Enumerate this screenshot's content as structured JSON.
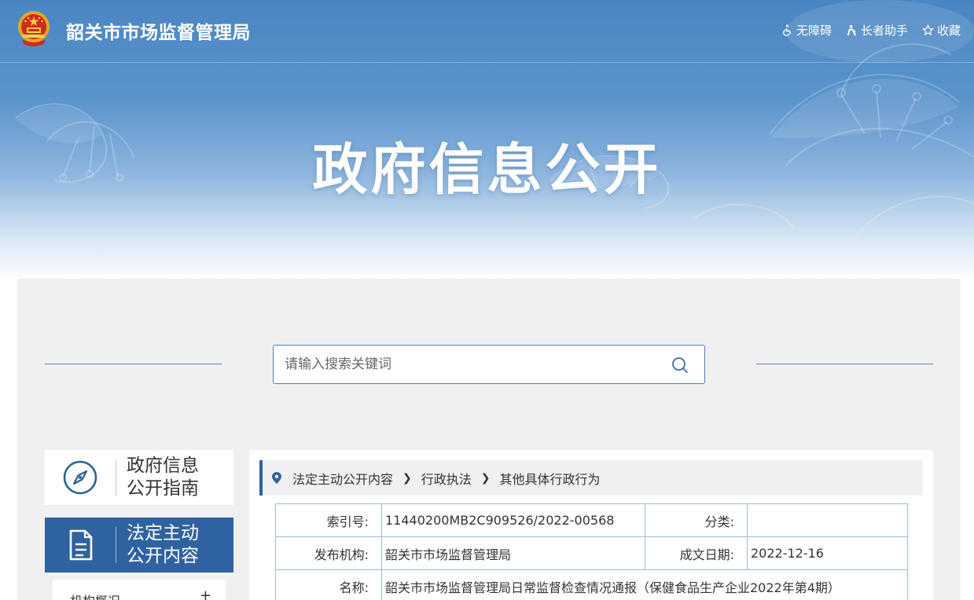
{
  "header": {
    "site_name": "韶关市市场监督管理局",
    "tools": [
      {
        "label": "无障碍",
        "icon": "accessibility-icon"
      },
      {
        "label": "长者助手",
        "icon": "elder-helper-icon"
      },
      {
        "label": "收藏",
        "icon": "star-icon"
      }
    ]
  },
  "banner": {
    "title": "政府信息公开"
  },
  "search": {
    "placeholder": "请输入搜索关键词"
  },
  "sidebar": {
    "cards": [
      {
        "label": "政府信息公开指南",
        "icon": "compass-icon",
        "active": false
      },
      {
        "label": "法定主动公开内容",
        "icon": "document-icon",
        "active": true
      }
    ],
    "list_item": {
      "label": "机构概况",
      "toggle": "+"
    }
  },
  "breadcrumb": {
    "items": [
      "法定主动公开内容",
      "行政执法",
      "其他具体行政行为"
    ]
  },
  "meta": {
    "index_label": "索引号:",
    "index_value": "11440200MB2C909526/2022-00568",
    "category_label": "分类:",
    "category_value": "",
    "publisher_label": "发布机构:",
    "publisher_value": "韶关市市场监督管理局",
    "date_label": "成文日期:",
    "date_value": "2022-12-16",
    "name_label": "名称:",
    "name_value": "韶关市市场监督管理局日常监督检查情况通报（保健食品生产企业2022年第4期）"
  },
  "colors": {
    "primary": "#2f62a0",
    "banner_top": "#4a86c3",
    "panel_bg": "#f0f0f0",
    "table_border": "#9dbad6"
  }
}
